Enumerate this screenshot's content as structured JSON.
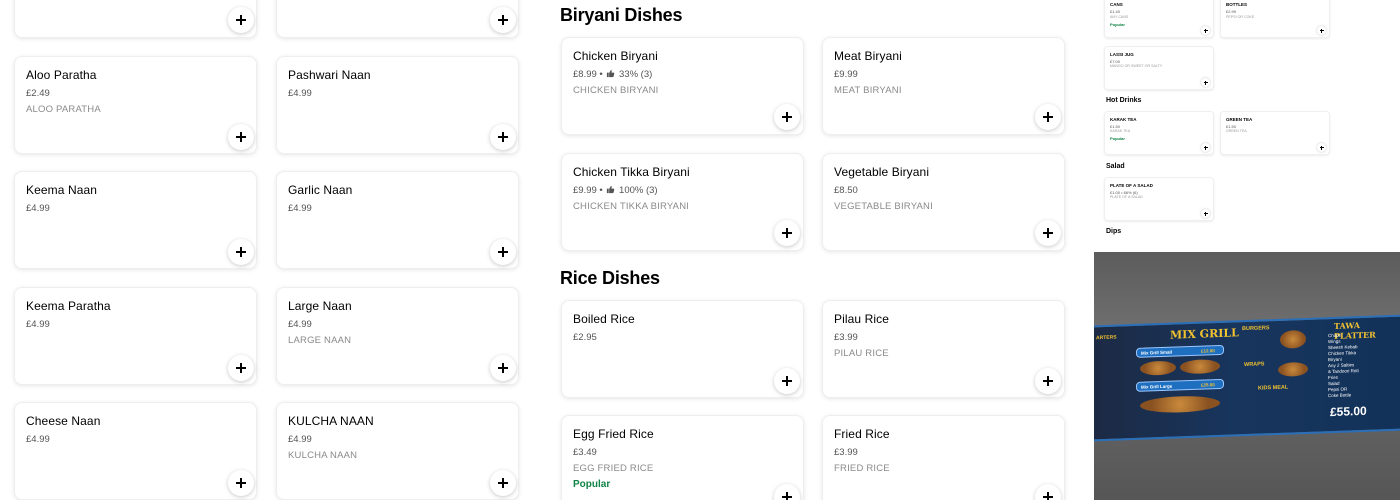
{
  "left_menu": {
    "items": [
      {
        "name": "Aloo Paratha",
        "price": "£2.49",
        "desc": "ALOO PARATHA"
      },
      {
        "name": "Pashwari Naan",
        "price": "£4.99",
        "desc": ""
      },
      {
        "name": "Keema Naan",
        "price": "£4.99",
        "desc": ""
      },
      {
        "name": "Garlic Naan",
        "price": "£4.99",
        "desc": ""
      },
      {
        "name": "Keema Paratha",
        "price": "£4.99",
        "desc": ""
      },
      {
        "name": "Large Naan",
        "price": "£4.99",
        "desc": "LARGE NAAN"
      },
      {
        "name": "Cheese Naan",
        "price": "£4.99",
        "desc": ""
      },
      {
        "name": "KULCHA NAAN",
        "price": "£4.99",
        "desc": "KULCHA NAAN"
      }
    ]
  },
  "biryani": {
    "title": "Biryani Dishes",
    "items": [
      {
        "name": "Chicken Biryani",
        "price": "£8.99 •",
        "rating": "33% (3)",
        "desc": "CHICKEN BIRYANI"
      },
      {
        "name": "Meat Biryani",
        "price": "£9.99",
        "desc": "MEAT BIRYANI"
      },
      {
        "name": "Chicken Tikka Biryani",
        "price": "£9.99 •",
        "rating": "100% (3)",
        "desc": "CHICKEN TIKKA BIRYANI"
      },
      {
        "name": "Vegetable Biryani",
        "price": "£8.50",
        "desc": "VEGETABLE BIRYANI"
      }
    ]
  },
  "rice": {
    "title": "Rice Dishes",
    "items": [
      {
        "name": "Boiled Rice",
        "price": "£2.95",
        "desc": ""
      },
      {
        "name": "Pilau Rice",
        "price": "£3.99",
        "desc": "PILAU RICE"
      },
      {
        "name": "Egg Fried Rice",
        "price": "£3.49",
        "desc": "EGG FRIED RICE",
        "badge": "Popular"
      },
      {
        "name": "Fried Rice",
        "price": "£3.99",
        "desc": "FRIED RICE"
      }
    ]
  },
  "side_panel": {
    "cans": {
      "name": "CANS",
      "price": "£1.40",
      "desc": "ANY CANS",
      "badge": "Popular"
    },
    "bottles": {
      "name": "BOTTLES",
      "price": "£2.99",
      "desc": "PEPSI OR COKE"
    },
    "lassi": {
      "name": "LASSI JUG",
      "price": "£7.00",
      "desc": "MANGO OR SWEET OR SALTY"
    },
    "hot_drinks_heading": "Hot Drinks",
    "karak": {
      "name": "KARAK TEA",
      "price": "£1.50",
      "desc": "KARAK TEA",
      "badge": "Popular"
    },
    "green": {
      "name": "GREEN TEA",
      "price": "£1.50",
      "desc": "GREEN TEA"
    },
    "salad_heading": "Salad",
    "salad": {
      "name": "PLATE OF A SALAD",
      "price": "£1.00 •",
      "rating": "66% (6)",
      "desc": "PLATE OF A SALAD"
    },
    "dips_heading": "Dips"
  },
  "menu_photo": {
    "left_label": "ARTERS",
    "mix_grill": "MIX GRILL",
    "mix_small": "Mix Grill Small",
    "mix_small_price": "£12.00",
    "mix_large": "Mix Grill Large",
    "mix_large_price": "£25.00",
    "burgers": "BURGERS",
    "wraps": "WRAPS",
    "kids_meal": "KIDS MEAL",
    "platter": "TAWA PLATTER",
    "platter_items": "Chops\nWings\nSheesh Kebab\nChicken Tikka\nBiryani\nAny 2 Salties\n& Tandoori Roti\nFries\nSalad\nPepsi OR\nCoke Bottle",
    "platter_price": "£55.00"
  },
  "colors": {
    "popular_green": "#0e8345",
    "price_grey": "#545454",
    "desc_grey": "#8a8a8a"
  }
}
